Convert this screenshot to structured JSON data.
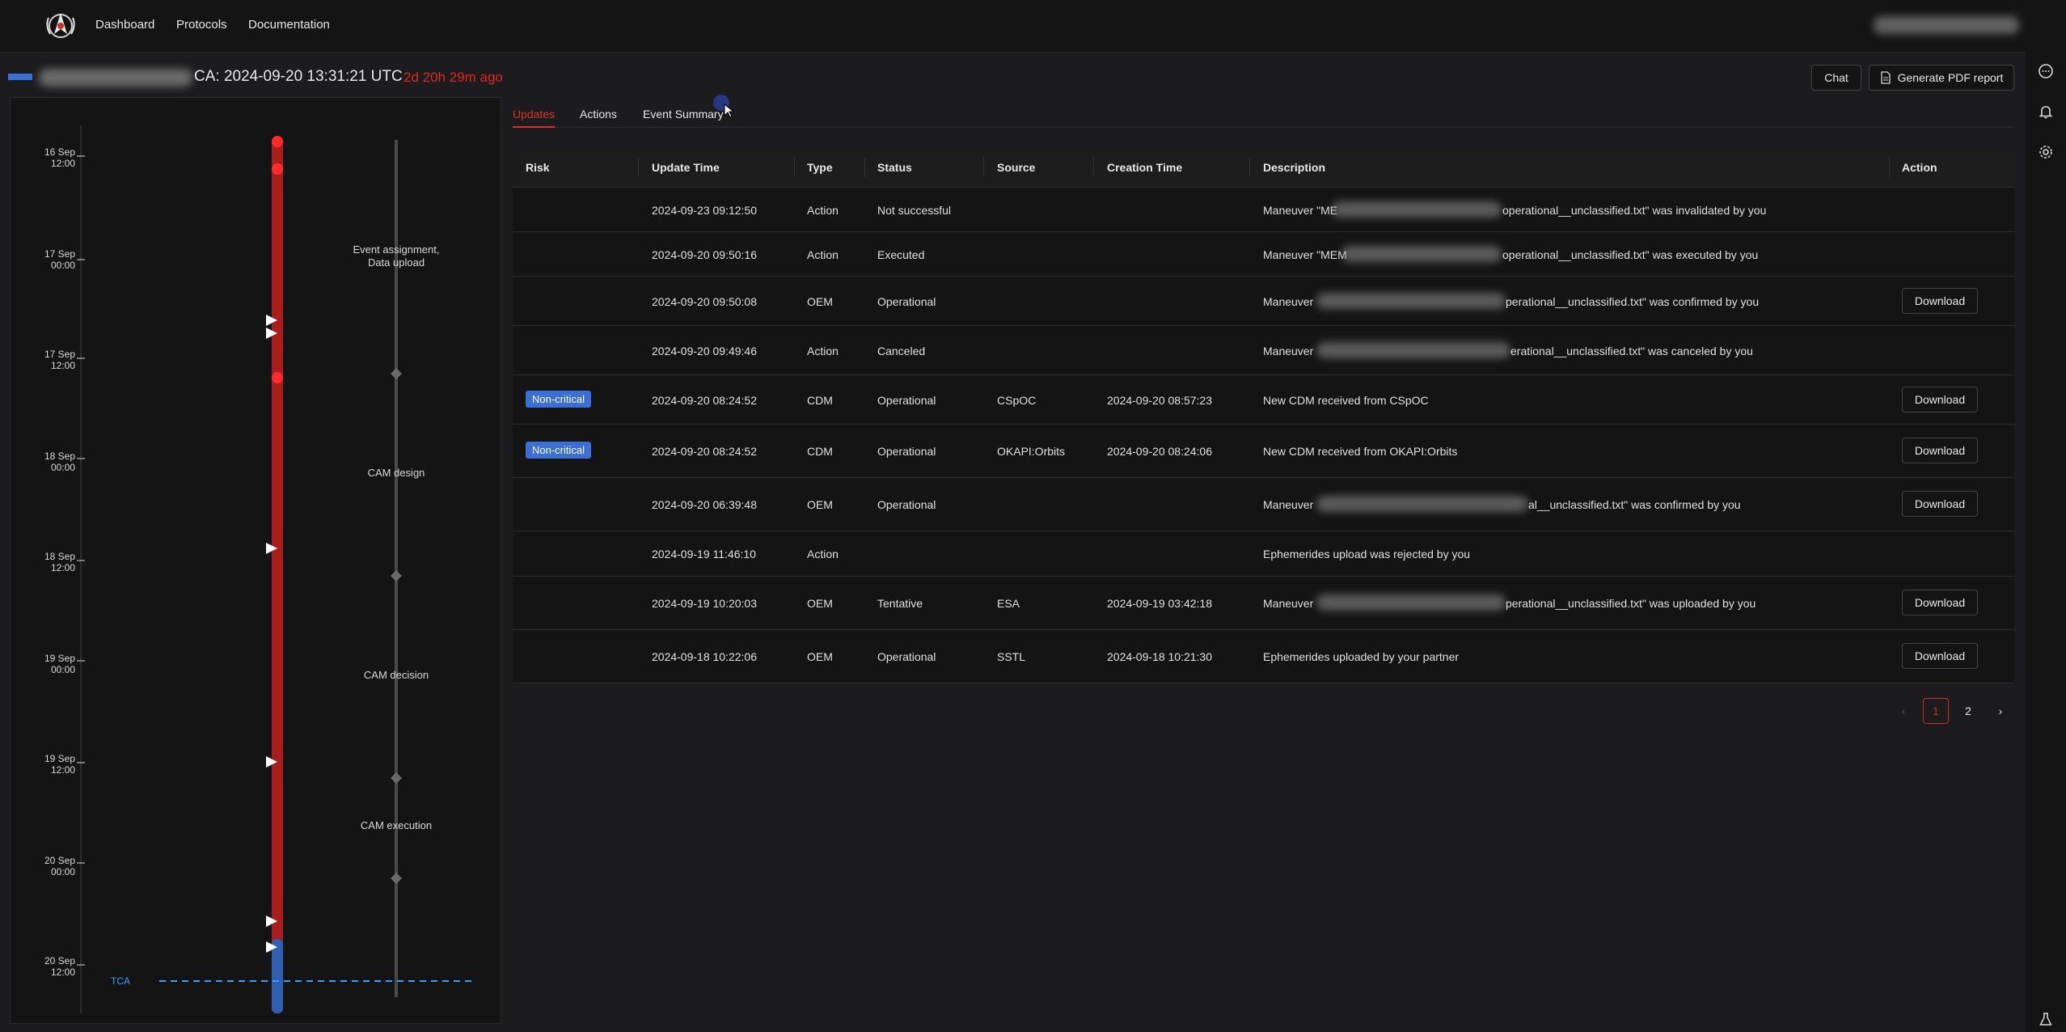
{
  "nav": {
    "items": [
      {
        "label": "Dashboard"
      },
      {
        "label": "Protocols"
      },
      {
        "label": "Documentation"
      }
    ]
  },
  "header": {
    "tca_text": "CA: 2024-09-20 13:31:21 UTC",
    "time_ago": "2d 20h 29m ago",
    "chat_label": "Chat",
    "pdf_label": "Generate PDF report"
  },
  "timeline": {
    "ticks": [
      {
        "line1": "16 Sep",
        "line2": "12:00"
      },
      {
        "line1": "17 Sep",
        "line2": "00:00"
      },
      {
        "line1": "17 Sep",
        "line2": "12:00"
      },
      {
        "line1": "18 Sep",
        "line2": "00:00"
      },
      {
        "line1": "18 Sep",
        "line2": "12:00"
      },
      {
        "line1": "19 Sep",
        "line2": "00:00"
      },
      {
        "line1": "19 Sep",
        "line2": "12:00"
      },
      {
        "line1": "20 Sep",
        "line2": "00:00"
      },
      {
        "line1": "20 Sep",
        "line2": "12:00"
      }
    ],
    "phases": [
      {
        "line1": "Event assignment,",
        "line2": "Data upload"
      },
      {
        "line1": "CAM design",
        "line2": ""
      },
      {
        "line1": "CAM decision",
        "line2": ""
      },
      {
        "line1": "CAM execution",
        "line2": ""
      }
    ],
    "tca_tag": "TCA"
  },
  "tabs": [
    {
      "label": "Updates",
      "active": true
    },
    {
      "label": "Actions",
      "active": false
    },
    {
      "label": "Event Summary",
      "active": false
    }
  ],
  "table": {
    "headers": [
      "Risk",
      "Update Time",
      "Type",
      "Status",
      "Source",
      "Creation Time",
      "Description",
      "Action"
    ],
    "rows": [
      {
        "risk": "",
        "update_time": "2024-09-23 09:12:50",
        "type": "Action",
        "status": "Not successful",
        "source": "",
        "creation_time": "",
        "desc_a": "Maneuver \"ME",
        "desc_b": "operational__unclassified.txt\" was invalidated by you",
        "action": ""
      },
      {
        "risk": "",
        "update_time": "2024-09-20 09:50:16",
        "type": "Action",
        "status": "Executed",
        "source": "",
        "creation_time": "",
        "desc_a": "Maneuver \"MEM",
        "desc_b": "operational__unclassified.txt\" was executed by you",
        "action": ""
      },
      {
        "risk": "",
        "update_time": "2024-09-20 09:50:08",
        "type": "OEM",
        "status": "Operational",
        "source": "",
        "creation_time": "",
        "desc_a": "Maneuver",
        "desc_b": "perational__unclassified.txt\" was confirmed by you",
        "action": "Download"
      },
      {
        "risk": "",
        "update_time": "2024-09-20 09:49:46",
        "type": "Action",
        "status": "Canceled",
        "source": "",
        "creation_time": "",
        "desc_a": "Maneuver",
        "desc_b": "erational__unclassified.txt\" was canceled by you",
        "action": ""
      },
      {
        "risk": "Non-critical",
        "update_time": "2024-09-20 08:24:52",
        "type": "CDM",
        "status": "Operational",
        "source": "CSpOC",
        "creation_time": "2024-09-20 08:57:23",
        "desc_a": "New CDM received from CSpOC",
        "desc_b": "",
        "action": "Download"
      },
      {
        "risk": "Non-critical",
        "update_time": "2024-09-20 08:24:52",
        "type": "CDM",
        "status": "Operational",
        "source": "OKAPI:Orbits",
        "creation_time": "2024-09-20 08:24:06",
        "desc_a": "New CDM received from OKAPI:Orbits",
        "desc_b": "",
        "action": "Download"
      },
      {
        "risk": "",
        "update_time": "2024-09-20 06:39:48",
        "type": "OEM",
        "status": "Operational",
        "source": "",
        "creation_time": "",
        "desc_a": "Maneuver",
        "desc_b": "al__unclassified.txt\" was confirmed by you",
        "action": "Download"
      },
      {
        "risk": "",
        "update_time": "2024-09-19 11:46:10",
        "type": "Action",
        "status": "",
        "source": "",
        "creation_time": "",
        "desc_a": "Ephemerides upload was rejected by you",
        "desc_b": "",
        "action": ""
      },
      {
        "risk": "",
        "update_time": "2024-09-19 10:20:03",
        "type": "OEM",
        "status": "Tentative",
        "source": "ESA",
        "creation_time": "2024-09-19 03:42:18",
        "desc_a": "Maneuver",
        "desc_b": "perational__unclassified.txt\" was uploaded by you",
        "action": "Download"
      },
      {
        "risk": "",
        "update_time": "2024-09-18 10:22:06",
        "type": "OEM",
        "status": "Operational",
        "source": "SSTL",
        "creation_time": "2024-09-18 10:21:30",
        "desc_a": "Ephemerides uploaded by your partner",
        "desc_b": "",
        "action": "Download"
      }
    ]
  },
  "pagination": {
    "prev": "‹",
    "pages": [
      "1",
      "2"
    ],
    "current": "1",
    "next": "›"
  },
  "colors": {
    "accent_red": "#d4342b",
    "badge_blue": "#3b6fd4",
    "tca_blue": "#3aa0ff"
  }
}
